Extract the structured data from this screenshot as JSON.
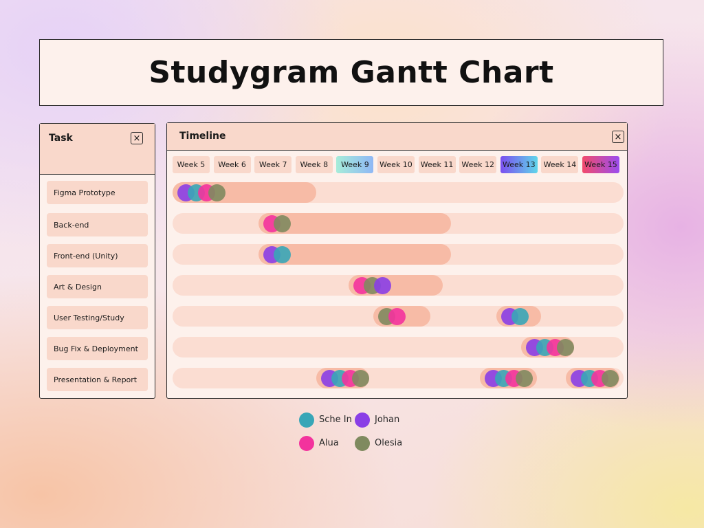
{
  "title": "Studygram Gantt Chart",
  "task_panel": {
    "title": "Task",
    "close": "×"
  },
  "timeline_panel": {
    "title": "Timeline",
    "close": "×"
  },
  "chart_data": {
    "type": "gantt",
    "title": "Studygram Gantt Chart",
    "weeks": [
      "Week 5",
      "Week 6",
      "Week 7",
      "Week 8",
      "Week 9",
      "Week 10",
      "Week 11",
      "Week 12",
      "Week 13",
      "Week 14",
      "Week 15"
    ],
    "highlighted_weeks": {
      "Week 9": [
        "#a6ecd9",
        "#8fb8f5"
      ],
      "Week 13": [
        "#7b4ff0",
        "#5fd6ea"
      ],
      "Week 15": [
        "#f24a6b",
        "#9a4df0"
      ]
    },
    "people": [
      {
        "name": "Sche In",
        "color": "#38a6b7"
      },
      {
        "name": "Johan",
        "color": "#8a3fe6"
      },
      {
        "name": "Alua",
        "color": "#f3339d"
      },
      {
        "name": "Olesia",
        "color": "#7f8a5f"
      }
    ],
    "tasks": [
      {
        "name": "Figma Prototype",
        "segments": [
          {
            "start": 5,
            "end": 8.5,
            "people": [
              "Johan",
              "Sche In",
              "Alua",
              "Olesia"
            ]
          }
        ]
      },
      {
        "name": "Back-end",
        "segments": [
          {
            "start": 7.1,
            "end": 11.8,
            "people": [
              "Alua",
              "Olesia"
            ]
          }
        ]
      },
      {
        "name": "Front-end (Unity)",
        "segments": [
          {
            "start": 7.1,
            "end": 11.8,
            "people": [
              "Johan",
              "Sche In"
            ]
          }
        ]
      },
      {
        "name": "Art & Design",
        "segments": [
          {
            "start": 9.3,
            "end": 11.6,
            "people": [
              "Alua",
              "Olesia",
              "Johan"
            ]
          }
        ]
      },
      {
        "name": "User Testing/Study",
        "segments": [
          {
            "start": 9.9,
            "end": 11.3,
            "people": [
              "Olesia",
              "Alua"
            ]
          },
          {
            "start": 12.9,
            "end": 14.0,
            "people": [
              "Johan",
              "Sche In"
            ]
          }
        ]
      },
      {
        "name": "Bug Fix & Deployment",
        "segments": [
          {
            "start": 13.5,
            "end": 14.8,
            "people": [
              "Johan",
              "Sche In",
              "Alua",
              "Olesia"
            ]
          }
        ]
      },
      {
        "name": "Presentation & Report",
        "segments": [
          {
            "start": 8.5,
            "end": 9.8,
            "people": [
              "Johan",
              "Sche In",
              "Alua",
              "Olesia"
            ]
          },
          {
            "start": 12.5,
            "end": 13.9,
            "people": [
              "Johan",
              "Sche In",
              "Alua",
              "Olesia"
            ]
          },
          {
            "start": 14.6,
            "end": 15.9,
            "people": [
              "Johan",
              "Sche In",
              "Alua",
              "Olesia"
            ]
          }
        ]
      }
    ],
    "legend_placement": "bottom-center"
  }
}
